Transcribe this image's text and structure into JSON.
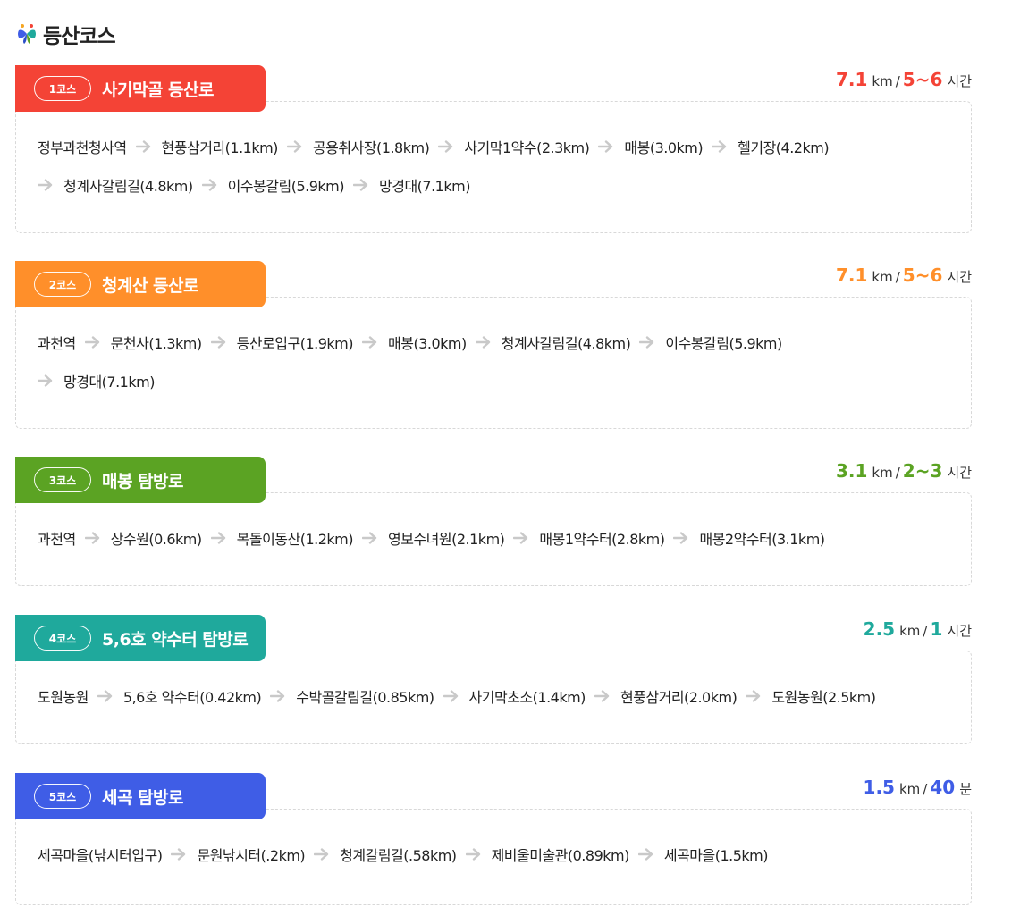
{
  "page": {
    "title": "등산코스"
  },
  "colors": {
    "course1": "#f44336",
    "course2": "#ff8f2a",
    "course3": "#5ba323",
    "course4": "#1fa99c",
    "course5": "#3f5de6",
    "arrow": "#c9c9c9"
  },
  "courses": [
    {
      "badge": "1코스",
      "name": "사기막골 등산로",
      "distance": "7.1",
      "distance_unit": "km",
      "sep": "/",
      "time": "5~6",
      "time_unit": "시간",
      "lines": [
        [
          "정부과천청사역",
          "현풍삼거리(1.1km)",
          "공용취사장(1.8km)",
          "사기막1약수(2.3km)",
          "매봉(3.0km)",
          "헬기장(4.2km)"
        ],
        [
          "청계사갈림길(4.8km)",
          "이수봉갈림(5.9km)",
          "망경대(7.1km)"
        ]
      ]
    },
    {
      "badge": "2코스",
      "name": "청계산 등산로",
      "distance": "7.1",
      "distance_unit": "km",
      "sep": "/",
      "time": "5~6",
      "time_unit": "시간",
      "lines": [
        [
          "과천역",
          "문천사(1.3km)",
          "등산로입구(1.9km)",
          "매봉(3.0km)",
          "청계사갈림길(4.8km)",
          "이수봉갈림(5.9km)"
        ],
        [
          "망경대(7.1km)"
        ]
      ]
    },
    {
      "badge": "3코스",
      "name": "매봉 탐방로",
      "distance": "3.1",
      "distance_unit": "km",
      "sep": "/",
      "time": "2~3",
      "time_unit": "시간",
      "lines": [
        [
          "과천역",
          "상수원(0.6km)",
          "복돌이동산(1.2km)",
          "영보수녀원(2.1km)",
          "매봉1약수터(2.8km)",
          "매봉2약수터(3.1km)"
        ]
      ]
    },
    {
      "badge": "4코스",
      "name": "5,6호 약수터 탐방로",
      "distance": "2.5",
      "distance_unit": "km",
      "sep": "/",
      "time": "1",
      "time_unit": "시간",
      "lines": [
        [
          "도원농원",
          "5,6호 약수터(0.42km)",
          "수박골갈림길(0.85km)",
          "사기막초소(1.4km)",
          "현풍삼거리(2.0km)",
          "도원농원(2.5km)"
        ]
      ]
    },
    {
      "badge": "5코스",
      "name": "세곡 탐방로",
      "distance": "1.5",
      "distance_unit": "km",
      "sep": "/",
      "time": "40",
      "time_unit": "분",
      "lines": [
        [
          "세곡마을(낚시터입구)",
          "문원낚시터(.2km)",
          "청계갈림길(.58km)",
          "제비울미술관(0.89km)",
          "세곡마을(1.5km)"
        ]
      ]
    }
  ]
}
